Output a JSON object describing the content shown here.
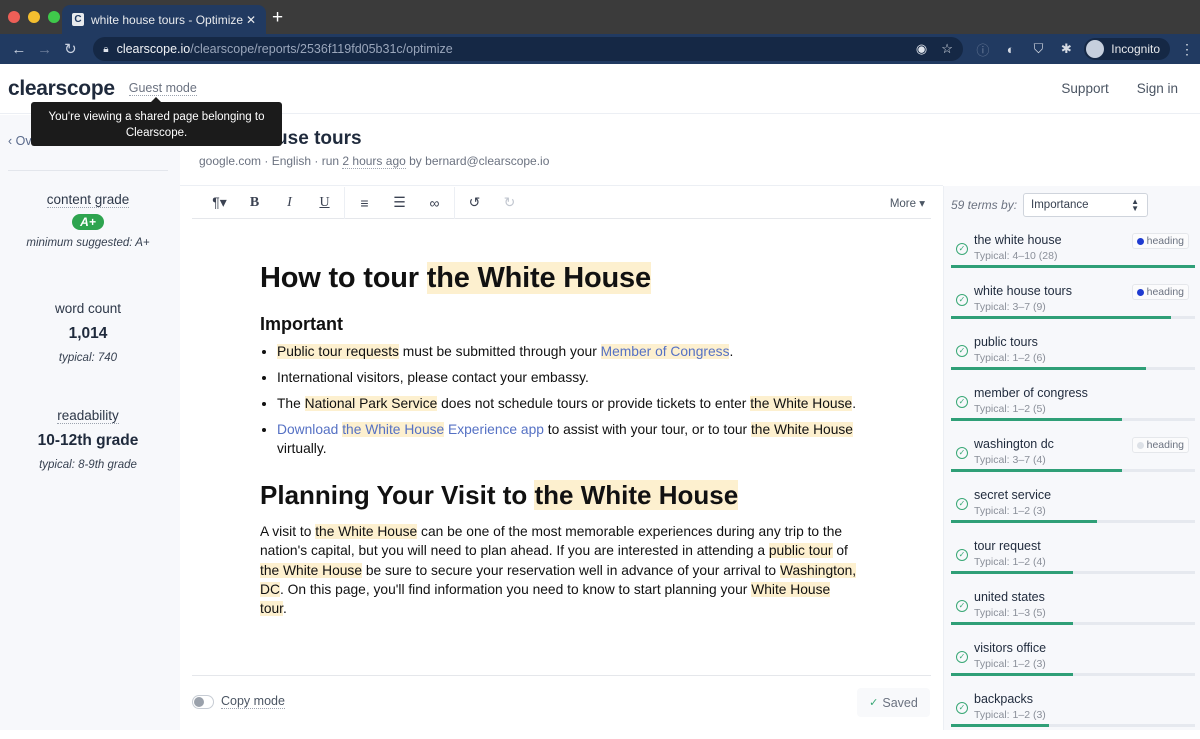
{
  "browser": {
    "tab_title": "white house tours - Optimize",
    "favicon_letter": "C",
    "url_host": "clearscope.io",
    "url_path": "/clearscope/reports/2536f119fd05b31c/optimize",
    "profile_label": "Incognito",
    "traffic_colors": [
      "#ed5f57",
      "#f5bf2f",
      "#3fc94b"
    ]
  },
  "header": {
    "logo": "clearscope",
    "guest_mode": "Guest mode",
    "tooltip": "You're viewing a shared page belonging to Clearscope.",
    "support": "Support",
    "sign_in": "Sign in"
  },
  "sidebar": {
    "overview_label": "Overview",
    "content_grade": {
      "label": "content grade",
      "value": "A+",
      "sub": "minimum suggested: A+"
    },
    "word_count": {
      "label": "word count",
      "value": "1,014",
      "sub": "typical: 740"
    },
    "readability": {
      "label": "readability",
      "value": "10-12th grade",
      "sub": "typical: 8-9th grade"
    }
  },
  "report": {
    "title": "white house tours",
    "meta_prefix": "google.com · English · run ",
    "meta_time": "2 hours ago",
    "meta_suffix": " by bernard@clearscope.io"
  },
  "toolbar": {
    "paragraph": "¶▾",
    "bold": "B",
    "italic": "I",
    "underline": "U",
    "ordered_list": "⒈",
    "bullet_list": "☰",
    "link": "🔗",
    "undo": "↺",
    "redo": "↻",
    "more": "More ▾"
  },
  "document": {
    "h1_a": "How to tour ",
    "h1_b": "the White House",
    "h2": "Important",
    "li1": {
      "a": "Public tour requests",
      "b": " must be submitted through your ",
      "c": "Member of Congress",
      "d": "."
    },
    "li2": "International visitors, please contact your embassy.",
    "li3": {
      "a": "The ",
      "b": "National Park Service",
      "c": " does not schedule tours or provide tickets to enter ",
      "d": "the White House",
      "e": "."
    },
    "li4": {
      "a": "Download ",
      "b": "the White House",
      "c": " Experience app",
      "d": " to assist with your tour, or to tour ",
      "e": "the White House",
      "f": " virtually."
    },
    "h1b_a": "Planning Your Visit to ",
    "h1b_b": "the White House",
    "p": {
      "a": "A visit to ",
      "b": "the White House",
      "c": " can be one of the most memorable experiences during any trip to the nation's capital, but you will need to plan ahead. If you are interested in attending a ",
      "d": "public tour",
      "e": " of ",
      "f": "the White House",
      "g": " be sure to secure your reservation well in advance of your arrival to ",
      "h": "Washington, DC",
      "i": ". On this page, you'll find information you need to know to start planning your ",
      "j": "White House tour",
      "k": "."
    }
  },
  "footer": {
    "copy_mode": "Copy mode",
    "saved": "Saved"
  },
  "terms_panel": {
    "count_label": "59 terms by:",
    "sort_value": "Importance",
    "terms": [
      {
        "name": "the white house",
        "typical": "Typical: 4–10 (28)",
        "badge": "heading",
        "badge_color": "#1f3bd1",
        "progress": 1.0
      },
      {
        "name": "white house tours",
        "typical": "Typical: 3–7 (9)",
        "badge": "heading",
        "badge_color": "#1f3bd1",
        "progress": 0.9
      },
      {
        "name": "public tours",
        "typical": "Typical: 1–2 (6)",
        "badge": null,
        "progress": 0.8
      },
      {
        "name": "member of congress",
        "typical": "Typical: 1–2 (5)",
        "badge": null,
        "progress": 0.7
      },
      {
        "name": "washington dc",
        "typical": "Typical: 3–7 (4)",
        "badge": "heading",
        "badge_color": "#dde1e7",
        "progress": 0.7
      },
      {
        "name": "secret service",
        "typical": "Typical: 1–2 (3)",
        "badge": null,
        "progress": 0.6
      },
      {
        "name": "tour request",
        "typical": "Typical: 1–2 (4)",
        "badge": null,
        "progress": 0.5
      },
      {
        "name": "united states",
        "typical": "Typical: 1–3 (5)",
        "badge": null,
        "progress": 0.5
      },
      {
        "name": "visitors office",
        "typical": "Typical: 1–2 (3)",
        "badge": null,
        "progress": 0.5
      },
      {
        "name": "backpacks",
        "typical": "Typical: 1–2 (3)",
        "badge": null,
        "progress": 0.4
      }
    ]
  }
}
